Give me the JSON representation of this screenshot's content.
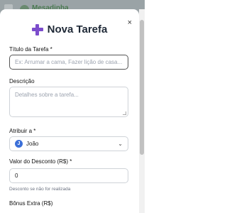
{
  "background": {
    "app_name": "Mesadinha"
  },
  "modal": {
    "title": "Nova Tarefa",
    "close": "×",
    "task_title": {
      "label": "Título da Tarefa *",
      "placeholder": "Ex: Arrumar a cama, Fazer lição de casa..."
    },
    "description": {
      "label": "Descrição",
      "placeholder": "Detalhes sobre a tarefa..."
    },
    "assign": {
      "label": "Atribuir a *",
      "avatar_initial": "J",
      "selected": "João"
    },
    "discount": {
      "label": "Valor do Desconto (R$) *",
      "value": "0",
      "hint": "Desconto se não for realizada"
    },
    "bonus": {
      "label": "Bônus Extra (R$)"
    }
  },
  "colors": {
    "accent": "#7c4dcc",
    "avatar": "#3b6fd8"
  }
}
